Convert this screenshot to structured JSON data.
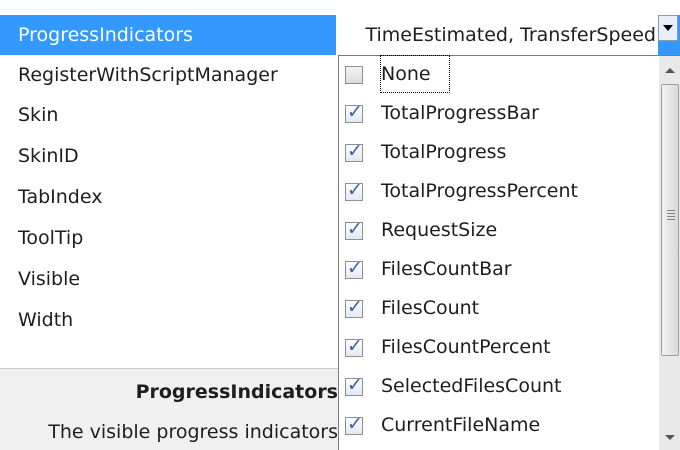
{
  "property_grid": {
    "rows": [
      {
        "name": "ProgressIndicators",
        "selected": true
      },
      {
        "name": "RegisterWithScriptManager"
      },
      {
        "name": "Skin"
      },
      {
        "name": "SkinID"
      },
      {
        "name": "TabIndex"
      },
      {
        "name": "ToolTip"
      },
      {
        "name": "Visible"
      },
      {
        "name": "Width"
      }
    ],
    "selected_value": "TimeEstimated, TransferSpeed"
  },
  "description": {
    "title": "ProgressIndicators",
    "text": "The visible progress indicators"
  },
  "dropdown": {
    "items": [
      {
        "label": "None",
        "checked": false,
        "focused": true
      },
      {
        "label": "TotalProgressBar",
        "checked": true
      },
      {
        "label": "TotalProgress",
        "checked": true
      },
      {
        "label": "TotalProgressPercent",
        "checked": true
      },
      {
        "label": "RequestSize",
        "checked": true
      },
      {
        "label": "FilesCountBar",
        "checked": true
      },
      {
        "label": "FilesCount",
        "checked": true
      },
      {
        "label": "FilesCountPercent",
        "checked": true
      },
      {
        "label": "SelectedFilesCount",
        "checked": true
      },
      {
        "label": "CurrentFileName",
        "checked": true
      }
    ]
  },
  "colors": {
    "selection": "#3399ff",
    "checkmark": "#3c5fa8",
    "description_bg": "#f0f0f0"
  }
}
